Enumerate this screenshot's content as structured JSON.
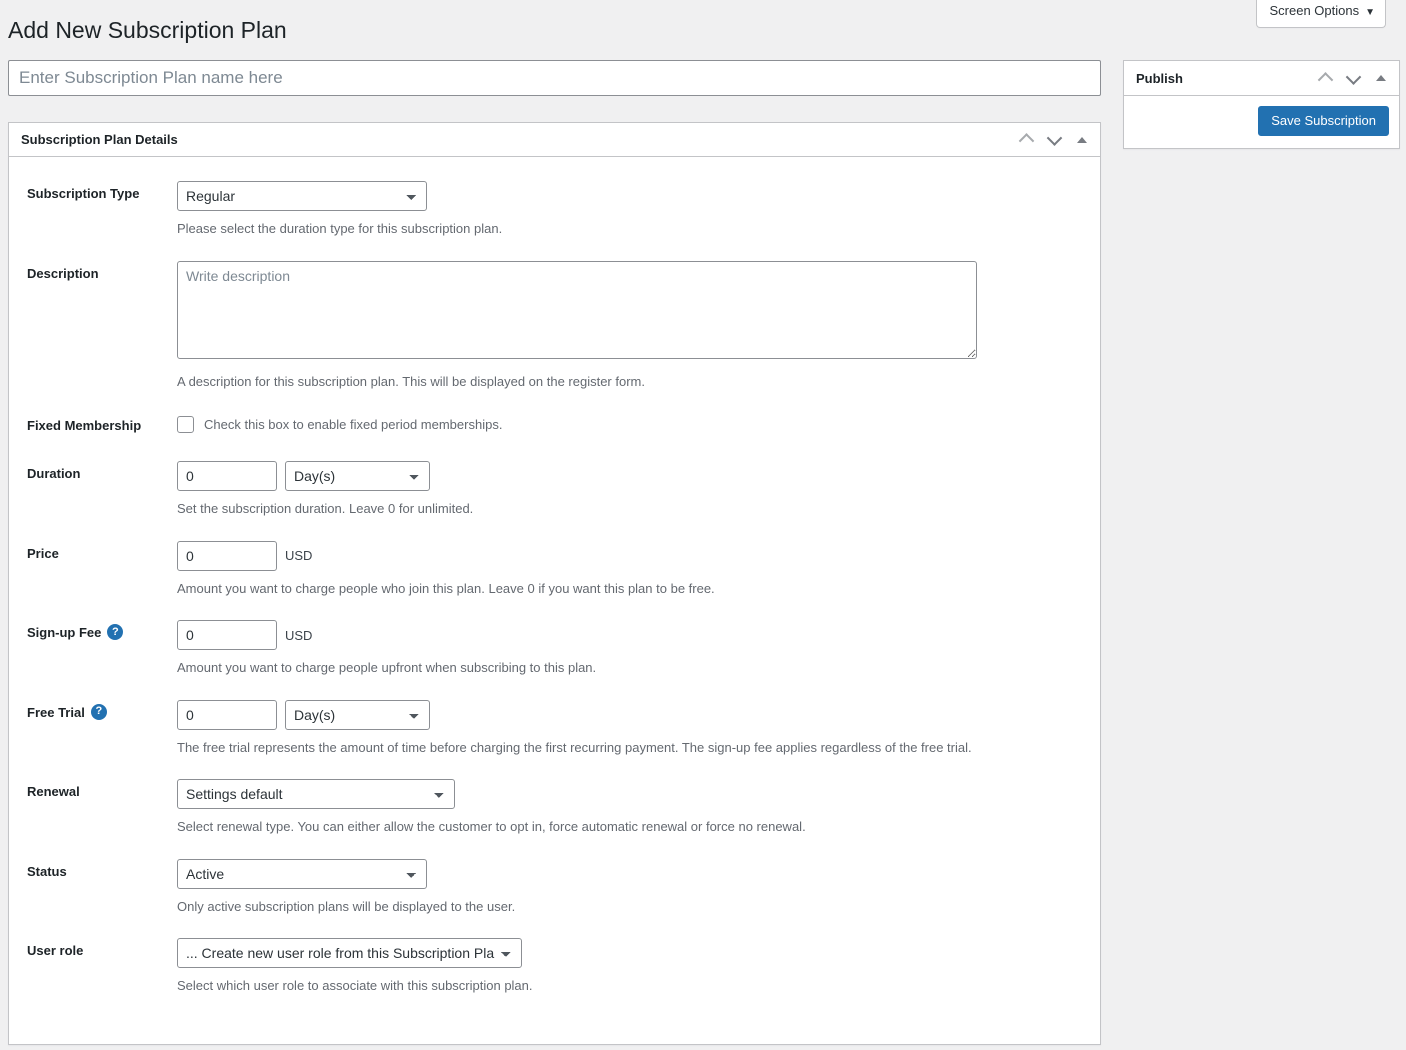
{
  "screen_options": {
    "label": "Screen Options",
    "caret": "chevron-down"
  },
  "page_title": "Add New Subscription Plan",
  "title_input": {
    "value": "",
    "placeholder": "Enter Subscription Plan name here"
  },
  "metabox": {
    "title": "Subscription Plan Details",
    "controls": {
      "up": "order-up",
      "down": "order-down",
      "toggle": "toggle-panel"
    }
  },
  "fields": {
    "subscription_type": {
      "label": "Subscription Type",
      "value": "Regular",
      "options": [
        "Regular"
      ],
      "description": "Please select the duration type for this subscription plan."
    },
    "description": {
      "label": "Description",
      "value": "",
      "placeholder": "Write description",
      "description": "A description for this subscription plan. This will be displayed on the register form."
    },
    "fixed_membership": {
      "label": "Fixed Membership",
      "checkbox_label": "Check this box to enable fixed period memberships.",
      "checked": false
    },
    "duration": {
      "label": "Duration",
      "value": "0",
      "unit_value": "Day(s)",
      "unit_options": [
        "Day(s)"
      ],
      "description": "Set the subscription duration. Leave 0 for unlimited."
    },
    "price": {
      "label": "Price",
      "value": "0",
      "currency": "USD",
      "description": "Amount you want to charge people who join this plan. Leave 0 if you want this plan to be free."
    },
    "signup_fee": {
      "label": "Sign-up Fee",
      "help": "?",
      "value": "0",
      "currency": "USD",
      "description": "Amount you want to charge people upfront when subscribing to this plan."
    },
    "free_trial": {
      "label": "Free Trial",
      "help": "?",
      "value": "0",
      "unit_value": "Day(s)",
      "unit_options": [
        "Day(s)"
      ],
      "description": "The free trial represents the amount of time before charging the first recurring payment. The sign-up fee applies regardless of the free trial."
    },
    "renewal": {
      "label": "Renewal",
      "value": "Settings default",
      "options": [
        "Settings default"
      ],
      "description": "Select renewal type. You can either allow the customer to opt in, force automatic renewal or force no renewal."
    },
    "status": {
      "label": "Status",
      "value": "Active",
      "options": [
        "Active"
      ],
      "description": "Only active subscription plans will be displayed to the user."
    },
    "user_role": {
      "label": "User role",
      "value": "... Create new user role from this Subscription Plan",
      "options": [
        "... Create new user role from this Subscription Plan"
      ],
      "description": "Select which user role to associate with this subscription plan."
    }
  },
  "publish": {
    "title": "Publish",
    "save_label": "Save Subscription",
    "controls": {
      "up": "order-up",
      "down": "order-down",
      "toggle": "toggle-panel"
    }
  },
  "colors": {
    "accent": "#2271b1",
    "page_bg": "#f0f0f1",
    "panel_bg": "#ffffff",
    "border": "#c3c4c7",
    "text": "#1d2327",
    "muted_text": "#646970"
  }
}
